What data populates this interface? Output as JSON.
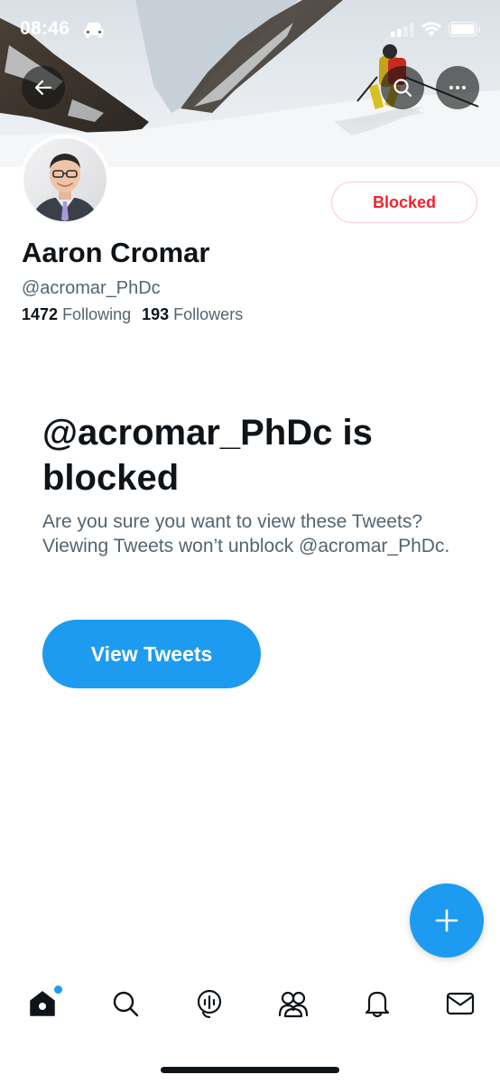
{
  "status_bar": {
    "time": "08:46"
  },
  "profile": {
    "display_name": "Aaron Cromar",
    "handle": "@acromar_PhDc",
    "following_count": "1472",
    "following_label": "Following",
    "followers_count": "193",
    "followers_label": "Followers",
    "blocked_button_label": "Blocked"
  },
  "blocked_notice": {
    "title": "@acromar_PhDc is blocked",
    "description": "Are you sure you want to view these Tweets? Viewing Tweets won’t unblock @acromar_PhDc.",
    "view_button_label": "View Tweets"
  },
  "tabbar": {
    "items": [
      "home-icon",
      "search-icon",
      "spaces-icon",
      "communities-icon",
      "notifications-icon",
      "messages-icon"
    ],
    "active": "home-icon"
  },
  "colors": {
    "accent": "#1d9bf0",
    "blocked_red": "#f4212e",
    "text_primary": "#0f1419",
    "text_secondary": "#536471"
  }
}
